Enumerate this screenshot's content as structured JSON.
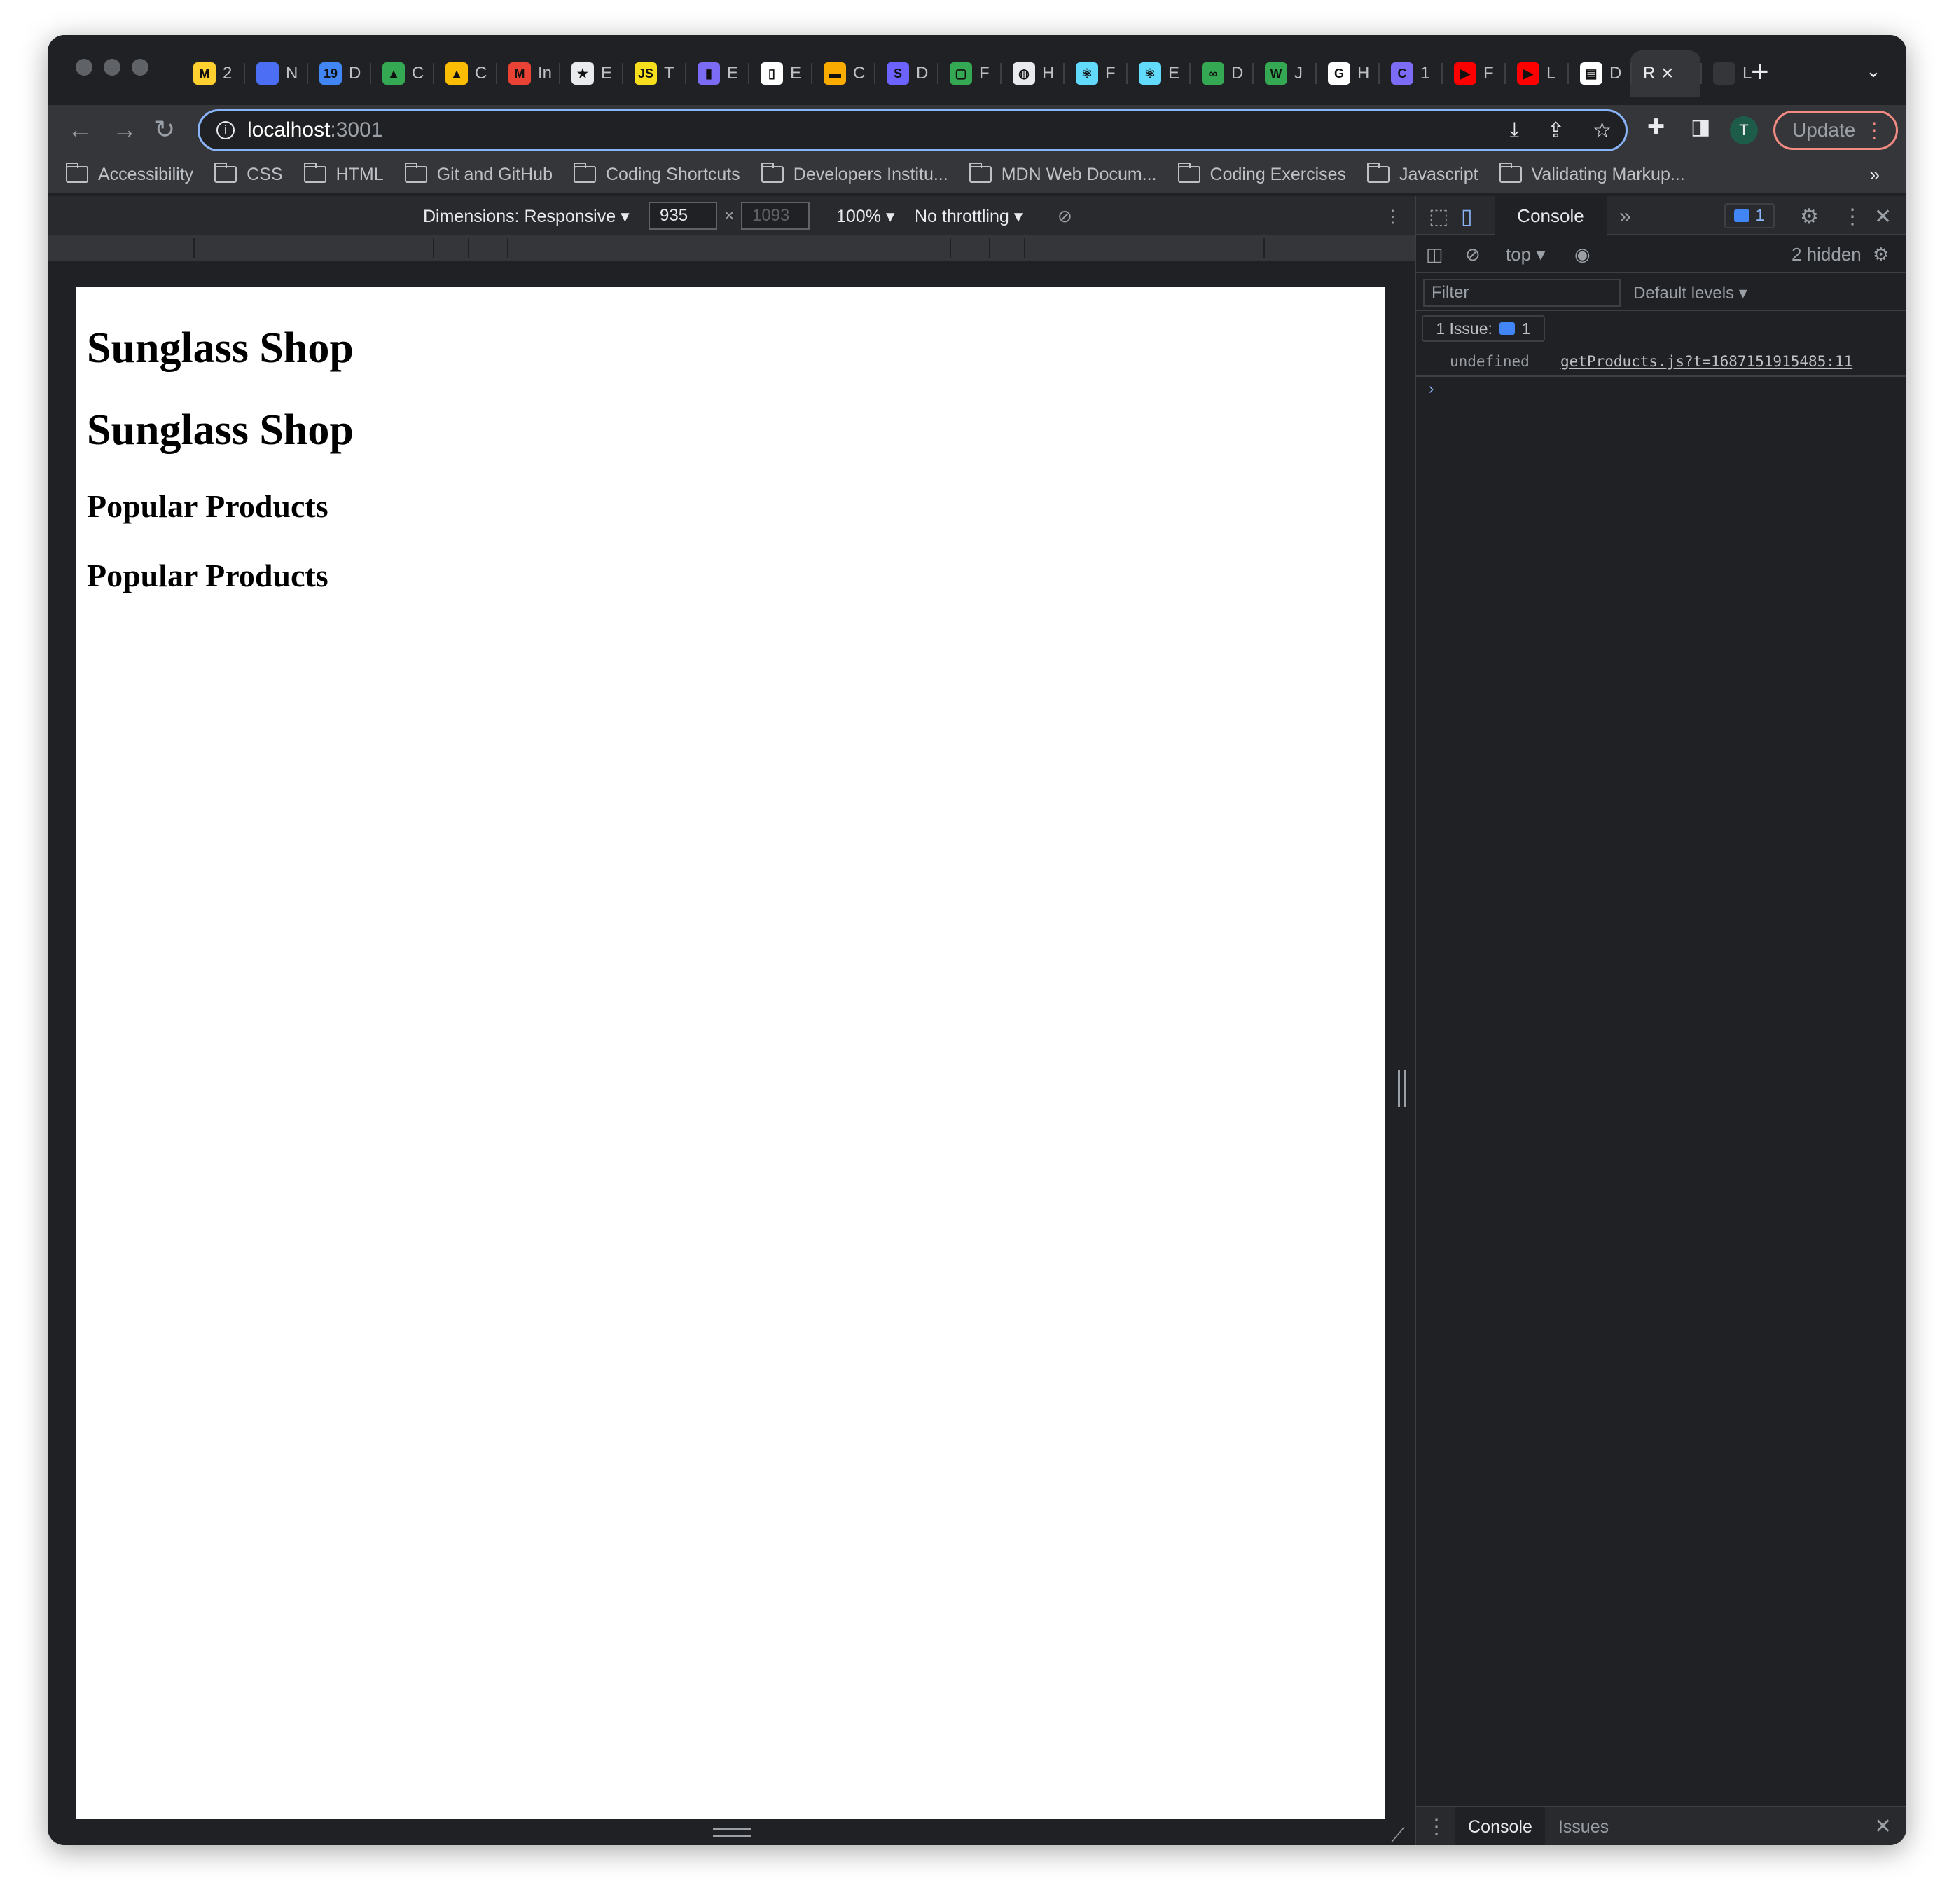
{
  "browser": {
    "tabs": [
      {
        "icon": "miro-icon",
        "glyph": "M",
        "color": "#ffd02f",
        "label": "2"
      },
      {
        "icon": "circle-icon",
        "glyph": "",
        "color": "#4c6ef5",
        "label": "N"
      },
      {
        "icon": "calendar-icon",
        "glyph": "19",
        "color": "#4285f4",
        "label": "D"
      },
      {
        "icon": "drive-icon",
        "glyph": "▲",
        "color": "#34a853",
        "label": "C"
      },
      {
        "icon": "drive-icon",
        "glyph": "▲",
        "color": "#fbbc04",
        "label": "C"
      },
      {
        "icon": "gmail-icon",
        "glyph": "M",
        "color": "#ea4335",
        "label": "In"
      },
      {
        "icon": "star-icon",
        "glyph": "★",
        "color": "#e8eaed",
        "label": "E"
      },
      {
        "icon": "js-icon",
        "glyph": "JS",
        "color": "#f7df1e",
        "label": "T"
      },
      {
        "icon": "tube-icon",
        "glyph": "▮",
        "color": "#7c6cf5",
        "label": "E"
      },
      {
        "icon": "page-icon",
        "glyph": "▯",
        "color": "#ffffff",
        "label": "E"
      },
      {
        "icon": "ruler-icon",
        "glyph": "▬",
        "color": "#f9ab00",
        "label": "C"
      },
      {
        "icon": "s-icon",
        "glyph": "S",
        "color": "#6c63ff",
        "label": "D"
      },
      {
        "icon": "frame-icon",
        "glyph": "▢",
        "color": "#34a853",
        "label": "F"
      },
      {
        "icon": "globe-icon",
        "glyph": "◍",
        "color": "#e8eaed",
        "label": "H"
      },
      {
        "icon": "react-icon",
        "glyph": "⚛",
        "color": "#61dafb",
        "label": "F"
      },
      {
        "icon": "react-icon",
        "glyph": "⚛",
        "color": "#61dafb",
        "label": "E"
      },
      {
        "icon": "link-icon",
        "glyph": "∞",
        "color": "#34a853",
        "label": "D"
      },
      {
        "icon": "w-icon",
        "glyph": "W",
        "color": "#34a853",
        "label": "J"
      },
      {
        "icon": "google-icon",
        "glyph": "G",
        "color": "#ffffff",
        "label": "H"
      },
      {
        "icon": "c-icon",
        "glyph": "C",
        "color": "#7c6cf5",
        "label": "1"
      },
      {
        "icon": "youtube-icon",
        "glyph": "▶",
        "color": "#ff0000",
        "label": "F"
      },
      {
        "icon": "youtube-icon",
        "glyph": "▶",
        "color": "#ff0000",
        "label": "L"
      },
      {
        "icon": "doc-icon",
        "glyph": "▤",
        "color": "#ffffff",
        "label": "D"
      },
      {
        "icon": "",
        "glyph": "",
        "color": "",
        "label": "R",
        "active": true
      },
      {
        "icon": "blank-icon",
        "glyph": "",
        "color": "#35363a",
        "label": "L"
      }
    ],
    "url_host": "localhost",
    "url_port": ":3001",
    "profile_initial": "T",
    "update_label": "Update",
    "bookmarks": [
      "Accessibility",
      "CSS",
      "HTML",
      "Git and GitHub",
      "Coding Shortcuts",
      "Developers Institu...",
      "MDN Web Docum...",
      "Coding Exercises",
      "Javascript",
      "Validating Markup..."
    ],
    "bookmarks_more": "»"
  },
  "device_toolbar": {
    "dimensions_label": "Dimensions: Responsive",
    "width": "935",
    "times": "×",
    "height": "1093",
    "zoom": "100%",
    "throttling": "No throttling"
  },
  "page": {
    "headings": [
      {
        "level": 1,
        "text": "Sunglass Shop"
      },
      {
        "level": 1,
        "text": "Sunglass Shop"
      },
      {
        "level": 2,
        "text": "Popular Products"
      },
      {
        "level": 2,
        "text": "Popular Products"
      }
    ]
  },
  "devtools": {
    "active_tab": "Console",
    "more_tabs": "»",
    "issues_count": "1",
    "context": "top",
    "hidden_count": "2 hidden",
    "filter_placeholder": "Filter",
    "levels": "Default levels",
    "issue_label": "1 Issue:",
    "issue_count": "1",
    "log_value": "undefined",
    "log_source": "getProducts.js?t=1687151915485:11",
    "prompt": "›",
    "drawer_tabs": [
      "Console",
      "Issues"
    ]
  }
}
